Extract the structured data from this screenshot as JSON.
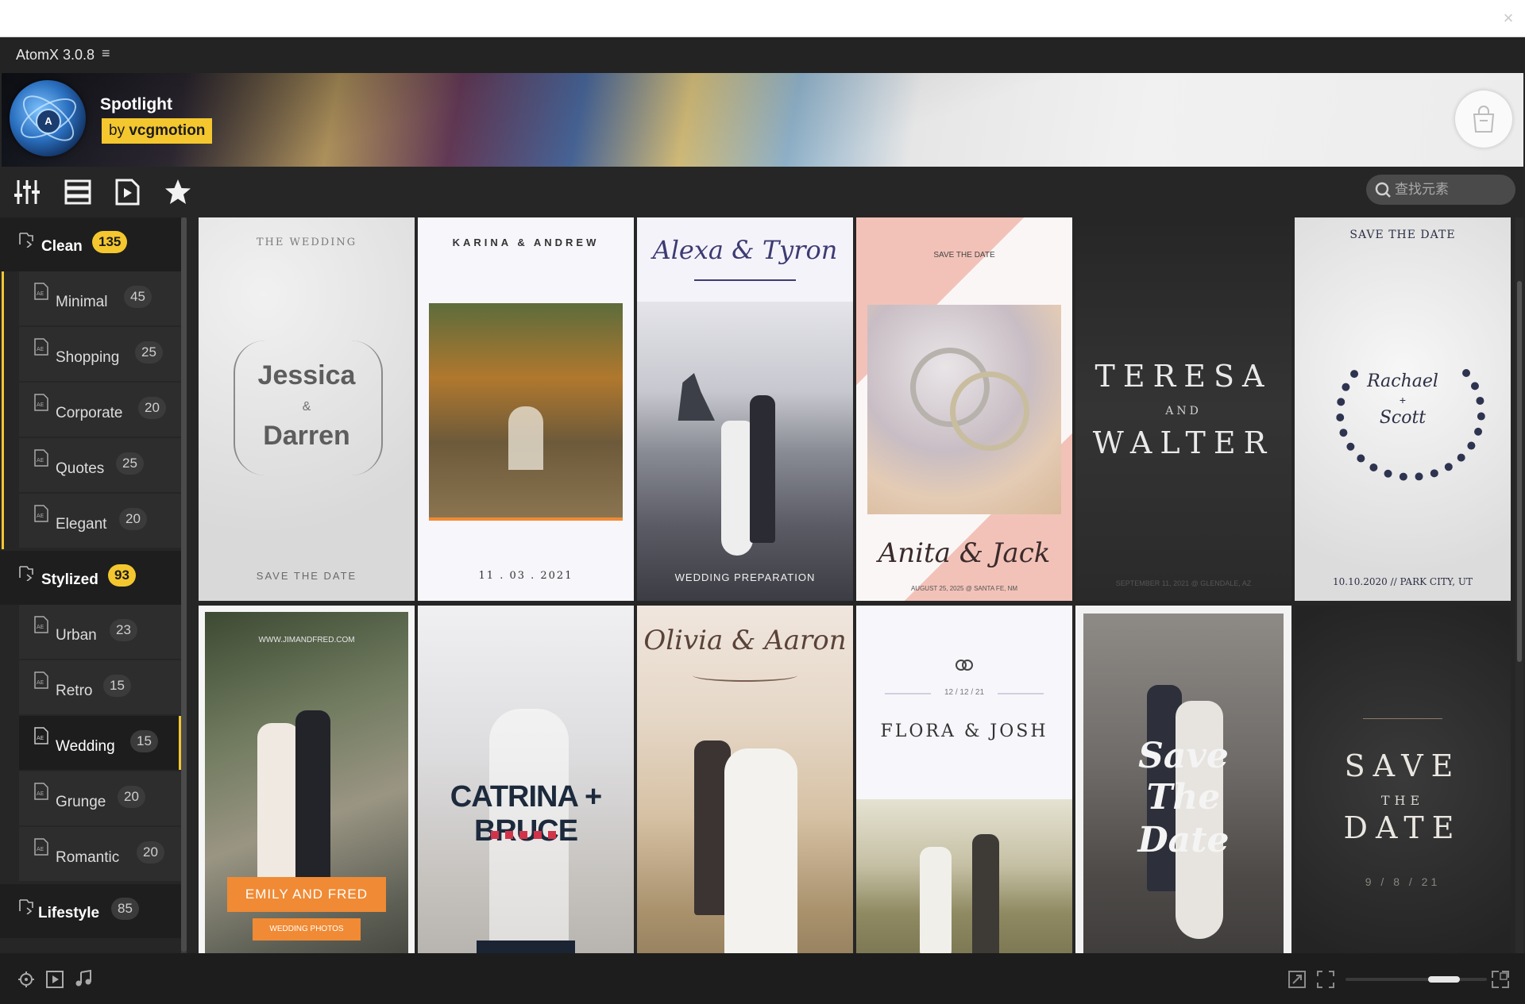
{
  "window": {
    "close_glyph": "×"
  },
  "app": {
    "title": "AtomX 3.0.8",
    "menu_glyph": "≡"
  },
  "banner": {
    "spotlight": "Spotlight",
    "by_prefix": "by",
    "by_name": "vcgmotion",
    "logo_letter": "A"
  },
  "search": {
    "placeholder": "查找元素"
  },
  "sidebar": {
    "groups": [
      {
        "label": "Clean",
        "count": "135"
      },
      {
        "label": "Stylized",
        "count": "93"
      },
      {
        "label": "Lifestyle",
        "count": "85"
      }
    ],
    "clean_items": [
      {
        "label": "Minimal",
        "count": "45"
      },
      {
        "label": "Shopping",
        "count": "25"
      },
      {
        "label": "Corporate",
        "count": "20"
      },
      {
        "label": "Quotes",
        "count": "25"
      },
      {
        "label": "Elegant",
        "count": "20"
      }
    ],
    "stylized_items": [
      {
        "label": "Urban",
        "count": "23"
      },
      {
        "label": "Retro",
        "count": "15"
      },
      {
        "label": "Wedding",
        "count": "15"
      },
      {
        "label": "Grunge",
        "count": "20"
      },
      {
        "label": "Romantic",
        "count": "20"
      }
    ]
  },
  "cards": {
    "c1": {
      "top": "THE WEDDING",
      "name1": "Jessica",
      "amp": "&",
      "name2": "Darren",
      "bottom": "SAVE THE DATE"
    },
    "c2": {
      "top": "KARINA & ANDREW",
      "date": "11 . 03 . 2021"
    },
    "c3": {
      "title": "Alexa & Tyron",
      "bottom": "WEDDING PREPARATION"
    },
    "c4": {
      "top": "SAVE THE DATE",
      "title": "Anita & Jack",
      "bottom": "AUGUST 25, 2025 @ SANTA FE, NM"
    },
    "c5": {
      "line1": "TERESA",
      "and": "AND",
      "line2": "WALTER",
      "bottom": "SEPTEMBER 11, 2021 @ GLENDALE, AZ"
    },
    "c6": {
      "top": "SAVE THE DATE",
      "name1": "Rachael",
      "plus": "+",
      "name2": "Scott",
      "bottom": "10.10.2020 // PARK CITY, UT"
    },
    "c7": {
      "url": "WWW.JIMANDFRED.COM",
      "button": "EMILY AND FRED",
      "sub": "WEDDING PHOTOS"
    },
    "c8": {
      "title": "CATRINA + BRUCE"
    },
    "c9": {
      "title": "Olivia & Aaron"
    },
    "c10": {
      "date": "12 / 12 / 21",
      "title": "FLORA & JOSH"
    },
    "c11": {
      "l1": "Save",
      "l2": "The",
      "l3": "Date"
    },
    "c12": {
      "l1": "SAVE",
      "l2": "THE",
      "l3": "DATE",
      "date": "9 / 8 / 21"
    }
  },
  "colors": {
    "accent": "#f4c72f",
    "dark": "#262626",
    "orange": "#f08a34"
  },
  "icons": {
    "toolbar": [
      "sliders-icon",
      "list-icon",
      "play-file-icon",
      "star-icon"
    ],
    "bottom_left": [
      "target-icon",
      "play-icon",
      "music-note-icon"
    ],
    "bottom_right": [
      "expand-icon",
      "fullscreen-icon",
      "grid-size-icon"
    ]
  }
}
